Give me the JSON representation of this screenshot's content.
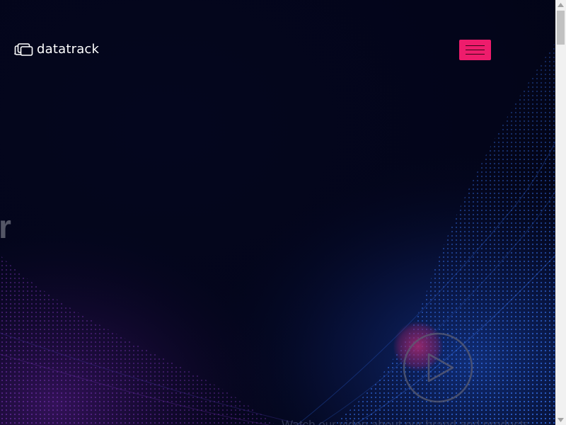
{
  "brand": {
    "name": "datatrack",
    "logo_icon": "stacked-screens-icon"
  },
  "header": {
    "menu_button": {
      "icon": "hamburger-menu-icon",
      "color": "#ee1c6c"
    }
  },
  "hero": {
    "headline_fragment": "r",
    "play_button_icon": "play-icon",
    "video_caption": "Watch our video about our brand and products"
  },
  "colors": {
    "background": "#03051a",
    "accent": "#ee1c6c",
    "wave_blue": "#1f5fd6",
    "wave_purple": "#7a2bb8"
  }
}
